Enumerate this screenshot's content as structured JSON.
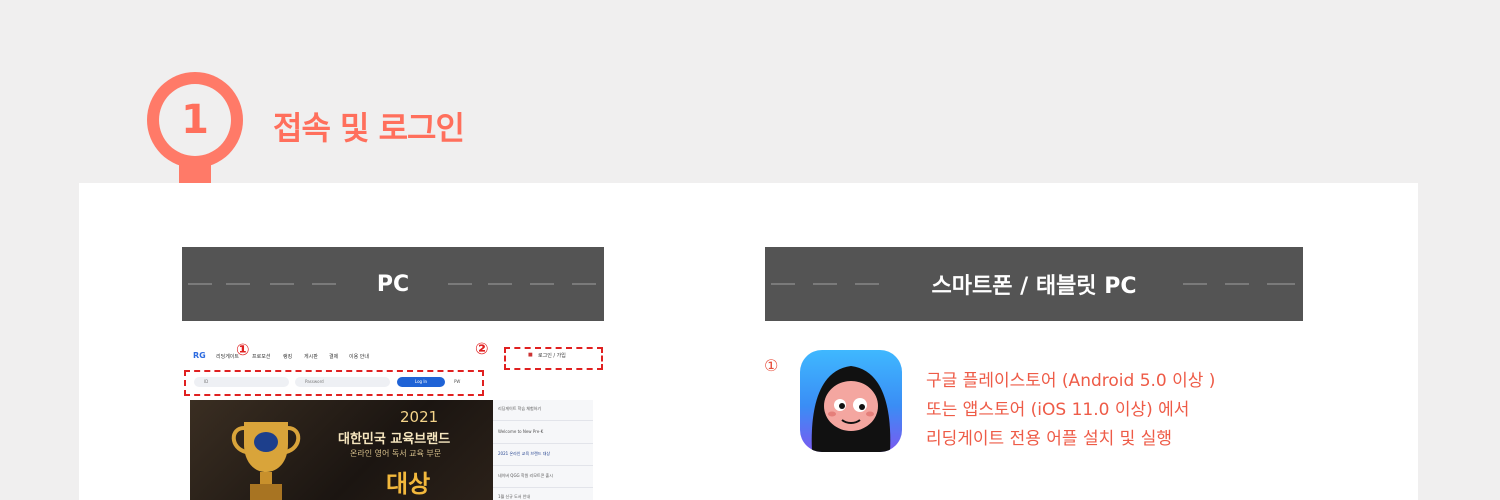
{
  "step": {
    "number": "1",
    "title": "접속 및 로그인"
  },
  "colors": {
    "accent": "#ff7a68",
    "text_accent": "#ee5b47",
    "header_bg": "#545454",
    "panel_bg": "#ffffff",
    "page_bg": "#f0efef"
  },
  "pc": {
    "header": "PC",
    "markers": [
      "①",
      "②"
    ],
    "nav_items": [
      "리딩게이트",
      "프로모션",
      "랭킹",
      "게시판",
      "결제",
      "이용 안내"
    ],
    "lang_login": "로그인 / 가입",
    "id_placeholder": "ID",
    "pw_placeholder": "Password",
    "login_button": "Log In",
    "find_pw": "PW",
    "banner": {
      "year": "2021",
      "line1": "대한민국 교육브랜드",
      "line2": "온라인 영어 독서 교육 부문",
      "line3": "대상"
    },
    "side_items": [
      "리딩게이트 학습 체험하기",
      "Welcome to New Pre-K",
      "2021 온라인 교육 브랜드 대상",
      "네이버 QGG 학원 리모트콘 출시",
      "1월 신규 도서 안내"
    ]
  },
  "mobile": {
    "header": "스마트폰 / 태블릿 PC",
    "marker": "①",
    "icon": "reading-gate-app-icon",
    "lines": [
      "구글 플레이스토어 (Android 5.0 이상 )",
      "또는 앱스토어 (iOS 11.0 이상) 에서",
      "리딩게이트 전용 어플 설치 및 실행"
    ]
  }
}
